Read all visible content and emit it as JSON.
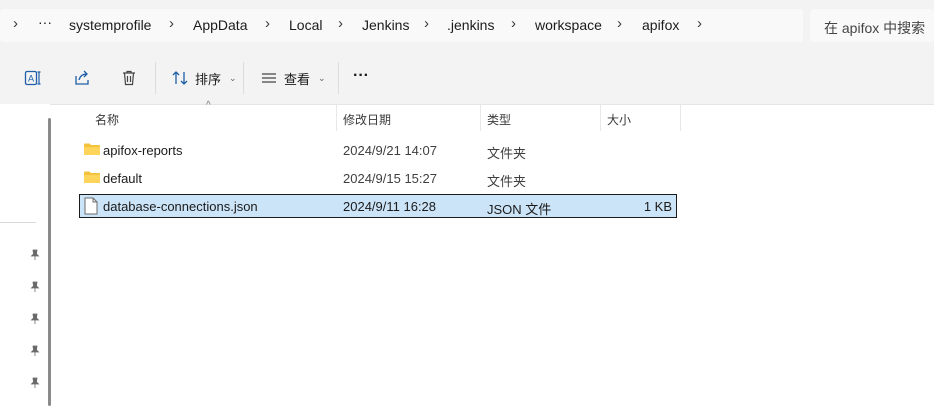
{
  "address_bar": {
    "overflow": "···",
    "breadcrumbs": [
      "systemprofile",
      "AppData",
      "Local",
      "Jenkins",
      ".jenkins",
      "workspace",
      "apifox"
    ]
  },
  "search": {
    "placeholder": "在 apifox 中搜索"
  },
  "toolbar": {
    "sort_label": "排序",
    "view_label": "查看",
    "more_label": "···",
    "icons": [
      "rename-icon",
      "share-icon",
      "delete-icon",
      "sort-icon",
      "view-icon",
      "more-icon"
    ]
  },
  "columns": {
    "name": "名称",
    "modified": "修改日期",
    "type": "类型",
    "size": "大小"
  },
  "files": [
    {
      "name": "apifox-reports",
      "modified": "2024/9/21 14:07",
      "type": "文件夹",
      "size": "",
      "icon": "folder-icon"
    },
    {
      "name": "default",
      "modified": "2024/9/15 15:27",
      "type": "文件夹",
      "size": "",
      "icon": "folder-icon"
    },
    {
      "name": "database-connections.json",
      "modified": "2024/9/11 16:28",
      "type": "JSON 文件",
      "size": "1 KB",
      "icon": "file-icon",
      "selected": true
    }
  ],
  "colors": {
    "selection": "#cce4f7",
    "folder": "#f4c33d",
    "accent": "#1f5fa8"
  }
}
